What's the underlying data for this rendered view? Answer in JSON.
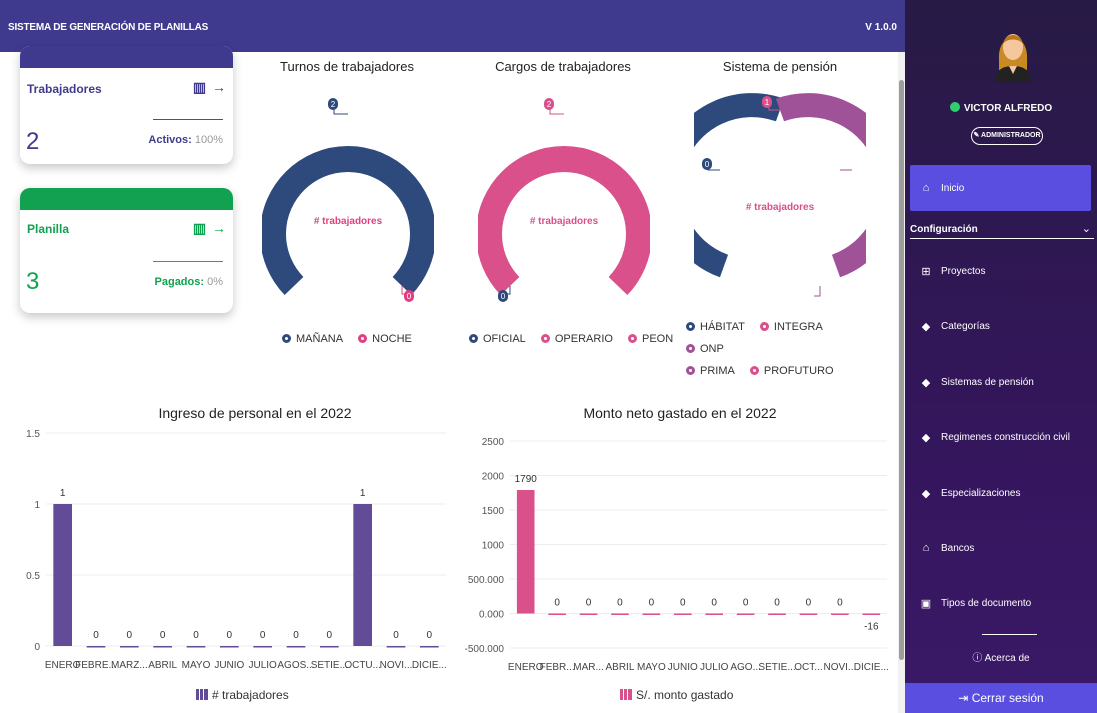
{
  "app": {
    "title": "SISTEMA DE GENERACIÓN DE PLANILLAS",
    "version": "V 1.0.0"
  },
  "cards": [
    {
      "title": "Trabajadores",
      "count": "2",
      "sub_label": "Activos:",
      "sub_value": "100%",
      "color": "#3f3a8d"
    },
    {
      "title": "Planilla",
      "count": "3",
      "sub_label": "Pagados:",
      "sub_value": "0%",
      "color": "#12a150"
    }
  ],
  "donuts": [
    {
      "title": "Turnos de trabajadores",
      "center": "# trabajadores",
      "callouts": [
        "2",
        "0"
      ],
      "legend": [
        "MAÑANA",
        "NOCHE"
      ],
      "colors": [
        "#2e4a7d",
        "#e0407f"
      ]
    },
    {
      "title": "Cargos de trabajadores",
      "center": "# trabajadores",
      "callouts": [
        "2",
        "0"
      ],
      "legend": [
        "OFICIAL",
        "OPERARIO",
        "PEON"
      ],
      "colors": [
        "#d9508a"
      ]
    },
    {
      "title": "Sistema de pensión",
      "center": "# trabajadores",
      "callouts": [
        "1",
        "0"
      ],
      "legend": [
        "HÁBITAT",
        "INTEGRA",
        "ONP",
        "PRIMA",
        "PROFUTURO"
      ],
      "colors": [
        "#2e4a7d",
        "#a05298"
      ]
    }
  ],
  "chart_data": [
    {
      "type": "bar",
      "title": "Ingreso de personal en el 2022",
      "categories": [
        "ENERO",
        "FEBRE...",
        "MARZ...",
        "ABRIL",
        "MAYO",
        "JUNIO",
        "JULIO",
        "AGOS...",
        "SETIE...",
        "OCTU...",
        "NOVI...",
        "DICIE..."
      ],
      "series": [
        {
          "name": "# trabajadores",
          "values": [
            1,
            0,
            0,
            0,
            0,
            0,
            0,
            0,
            0,
            1,
            0,
            0
          ]
        }
      ],
      "yticks": [
        "0",
        "0.5",
        "1",
        "1.5"
      ],
      "ylim": [
        0,
        1.5
      ],
      "color": "#624c97"
    },
    {
      "type": "bar",
      "title": "Monto neto gastado en el 2022",
      "categories": [
        "ENERO",
        "FEBR...",
        "MAR...",
        "ABRIL",
        "MAYO",
        "JUNIO",
        "JULIO",
        "AGO...",
        "SETIE...",
        "OCT...",
        "NOVI...",
        "DICIE..."
      ],
      "series": [
        {
          "name": "S/. monto gastado",
          "values": [
            1790,
            0,
            0,
            0,
            0,
            0,
            0,
            0,
            0,
            0,
            0,
            -16
          ]
        }
      ],
      "yticks": [
        "-500.000",
        "0.000",
        "500.000",
        "1000",
        "1500",
        "2000",
        "2500"
      ],
      "ylim": [
        -500,
        2500
      ],
      "color": "#d9508a"
    }
  ],
  "sidebar": {
    "user_name": "VICTOR ALFREDO",
    "role": "ADMINISTRADOR",
    "home": "Inicio",
    "section": "Configuración",
    "items": [
      "Proyectos",
      "Categorías",
      "Sistemas de pensión",
      "Regimenes construcción civil",
      "Especializaciones",
      "Bancos",
      "Tipos de documento"
    ],
    "about": "Acerca de",
    "logout": "Cerrar sesión"
  }
}
